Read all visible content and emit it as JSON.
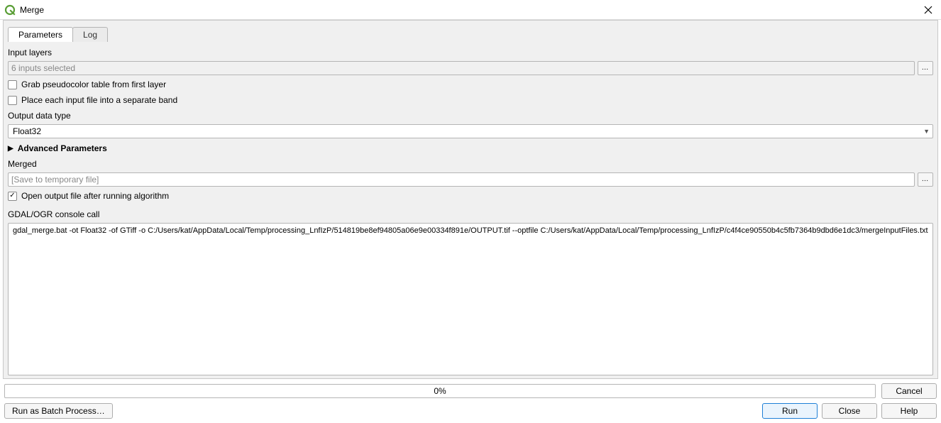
{
  "window": {
    "title": "Merge"
  },
  "tabs": {
    "parameters": "Parameters",
    "log": "Log"
  },
  "labels": {
    "input_layers": "Input layers",
    "output_data_type": "Output data type",
    "advanced": "Advanced Parameters",
    "merged": "Merged",
    "console": "GDAL/OGR console call"
  },
  "fields": {
    "input_layers_value": "6 inputs selected",
    "output_data_type_value": "Float32",
    "merged_placeholder": "[Save to temporary file]",
    "console_text": "gdal_merge.bat -ot Float32 -of GTiff -o C:/Users/kat/AppData/Local/Temp/processing_LnfIzP/514819be8ef94805a06e9e00334f891e/OUTPUT.tif --optfile C:/Users/kat/AppData/Local/Temp/processing_LnfIzP/c4f4ce90550b4c5fb7364b9dbd6e1dc3/mergeInputFiles.txt"
  },
  "checks": {
    "grab_pct": "Grab pseudocolor table from first layer",
    "separate_band": "Place each input file into a separate band",
    "open_output": "Open output file after running algorithm"
  },
  "progress": {
    "text": "0%"
  },
  "buttons": {
    "cancel": "Cancel",
    "batch": "Run as Batch Process…",
    "run": "Run",
    "close": "Close",
    "help": "Help",
    "ellipsis": "…"
  }
}
